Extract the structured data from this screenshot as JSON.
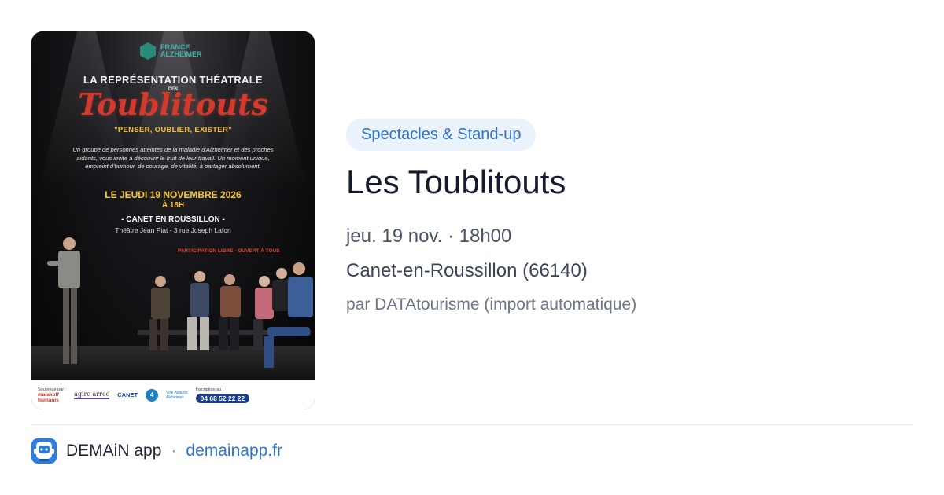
{
  "poster": {
    "logo_line1": "FRANCE",
    "logo_line2": "ALZHEIMER",
    "kicker": "LA REPRÉSENTATION THÉATRALE",
    "des": "DES",
    "title": "Toublitouts",
    "quote": "\"PENSER, OUBLIER, EXISTER\"",
    "body": "Un groupe de personnes atteintes de la maladie d'Alzheimer et des proches aidants, vous invite à découvrir le fruit de leur travail. Un moment unique, empreint d'humour, de courage, de vitalité, à partager absolument.",
    "date": "LE JEUDI 19 NOVEMBRE 2026",
    "time": "À 18H",
    "city": "- CANET EN ROUSSILLON -",
    "venue": "Théâtre Jean Piat - 3 rue Joseph Lafon",
    "free": "PARTICIPATION LIBRE - OUVERT À TOUS",
    "sponsor_label": "Soutenue par :",
    "sponsor1_line1": "malakoff",
    "sponsor1_line2": "humanis",
    "sponsor2": "agirc-arrco",
    "sponsor3": "CANET",
    "sponsor4_num": "4",
    "sponsor4_line1": "Ville Aidante",
    "sponsor4_line2": "Alzheimer",
    "inscription_label": "Inscription au :",
    "phone": "04 68 52 22 22"
  },
  "event": {
    "category": "Spectacles & Stand-up",
    "title": "Les Toublitouts",
    "when": "jeu. 19 nov. · 18h00",
    "where": "Canet-en-Roussillon (66140)",
    "source": "par DATAtourisme (import automatique)"
  },
  "footer": {
    "app_name": "DEMAiN app",
    "separator": "·",
    "site": "demainapp.fr",
    "icon": "demain-app-icon"
  },
  "colors": {
    "accent": "#2f73c8",
    "chip_bg": "#eaf2fc",
    "title": "#141b2d"
  }
}
